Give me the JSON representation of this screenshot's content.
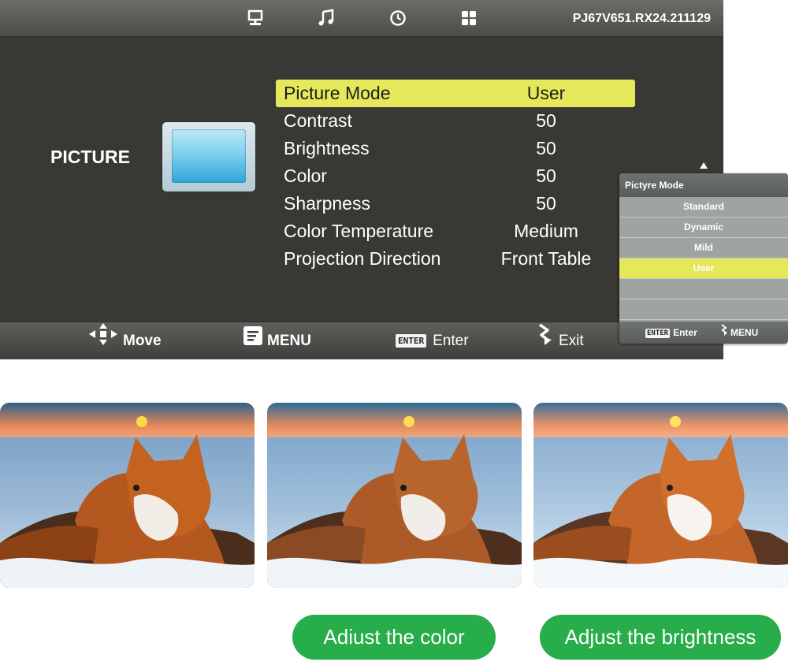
{
  "topbar": {
    "icons": [
      "network-icon",
      "music-icon",
      "clock-icon",
      "apps-icon"
    ],
    "version": "PJ67V651.RX24.211129"
  },
  "section": {
    "title": "PICTURE"
  },
  "menu": {
    "items": [
      {
        "label": "Picture Mode",
        "value": "User"
      },
      {
        "label": "Contrast",
        "value": "50"
      },
      {
        "label": "Brightness",
        "value": "50"
      },
      {
        "label": "Color",
        "value": "50"
      },
      {
        "label": "Sharpness",
        "value": "50"
      },
      {
        "label": "Color Temperature",
        "value": "Medium"
      },
      {
        "label": "Projection Direction",
        "value": "Front Table"
      }
    ],
    "selected_index": 0
  },
  "bottombar": {
    "move": "Move",
    "menu": "MENU",
    "enter_key": "ENTER",
    "enter": "Enter",
    "exit": "Exit"
  },
  "popup": {
    "title": "Pictyre Mode",
    "options": [
      "Standard",
      "Dynamic",
      "Mild",
      "User"
    ],
    "selected": "User",
    "footer_enter_key": "ENTER",
    "footer_enter": "Enter",
    "footer_menu": "MENU"
  },
  "captions": {
    "color": "Adiust the color",
    "brightness": "Adjust the brightness"
  },
  "colors": {
    "highlight": "#e4e85a",
    "panel": "#3a3835",
    "pill_green": "#27ad4a"
  }
}
